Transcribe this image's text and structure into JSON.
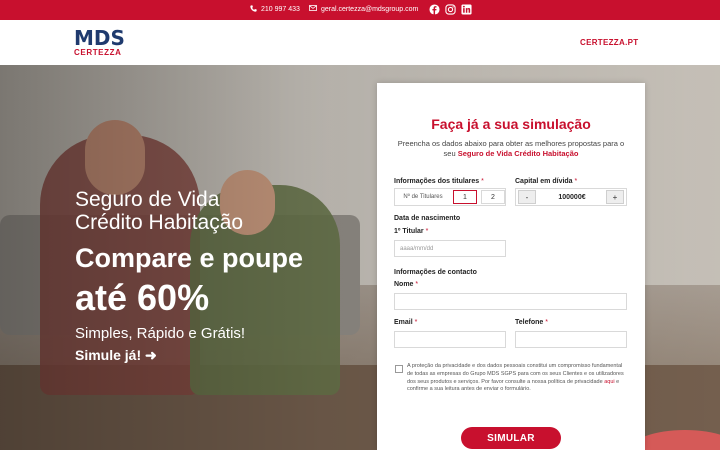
{
  "topbar": {
    "phone": "210 997 433",
    "email": "geral.certezza@mdsgroup.com",
    "social": [
      "facebook-icon",
      "instagram-icon",
      "linkedin-icon"
    ]
  },
  "header": {
    "logo_top": "MDS",
    "logo_bottom": "CERTEZZA",
    "site_link": "CERTEZZA.PT"
  },
  "hero": {
    "subtitle_line1": "Seguro de Vida",
    "subtitle_line2": "Crédito Habitação",
    "headline_line1": "Compare e poupe",
    "headline_line2": "até 60%",
    "tagline": "Simples, Rápido e Grátis!",
    "cta": "Simule já!",
    "cta_arrow": "➜"
  },
  "form": {
    "title": "Faça já a sua simulação",
    "description_prefix": "Preencha os dados abaixo para obter as melhores propostas para o seu ",
    "description_highlight": "Seguro de Vida Crédito Habitação",
    "titulares_label": "Informações dos titulares",
    "titulares_sublabel": "Nº de Titulares",
    "titulares_options": [
      "1",
      "2"
    ],
    "capital_label": "Capital em dívida",
    "capital_minus": "-",
    "capital_value": "100000€",
    "capital_plus": "+",
    "birth_section": "Data de nascimento",
    "birth_label": "1º Titular",
    "birth_placeholder": "aaaa/mm/dd",
    "contact_section": "Informações de contacto",
    "name_label": "Nome",
    "email_label": "Email",
    "phone_label": "Telefone",
    "required_mark": "*",
    "privacy_part1": "A proteção da privacidade e dos dados pessoais constitui um compromisso fundamental de todas as empresas do Grupo MDS SGPS para com os seus Clientes e os utilizadores dos seus produtos e serviços. Por favor consulte a nossa política de privacidade ",
    "privacy_link": "aqui",
    "privacy_part2": " e confirme a sua leitura antes de enviar o formulário.",
    "submit": "SIMULAR"
  },
  "colors": {
    "brand_red": "#c8102e",
    "brand_navy": "#1f3a6e"
  }
}
